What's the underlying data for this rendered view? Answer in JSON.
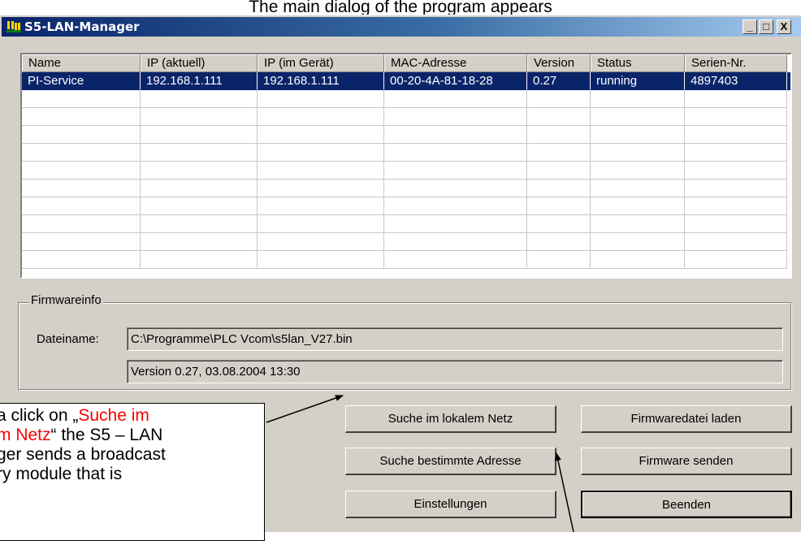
{
  "caption": "The main dialog of the program appears",
  "window": {
    "title": "S5-LAN-Manager",
    "controls": {
      "minimize": "_",
      "maximize": "□",
      "close": "X"
    }
  },
  "table": {
    "columns": [
      "Name",
      "IP (aktuell)",
      "IP (im Gerät)",
      "MAC-Adresse",
      "Version",
      "Status",
      "Serien-Nr."
    ],
    "rows": [
      [
        "PI-Service",
        "192.168.1.111",
        "192.168.1.111",
        "00-20-4A-81-18-28",
        "0.27",
        "running",
        "4897403"
      ]
    ],
    "selected_row": 0
  },
  "firmwareinfo": {
    "legend": "Firmwareinfo",
    "filename_label": "Dateiname:",
    "filename_value": "C:\\Programme\\PLC Vcom\\s5lan_V27.bin",
    "version_value": "Version 0.27, 03.08.2004 13:30"
  },
  "buttons": {
    "search_local": "Suche im lokalem Netz",
    "load_firmware_file": "Firmwaredatei laden",
    "search_address": "Suche bestimmte Adresse",
    "send_firmware": "Firmware senden",
    "settings": "Einstellungen",
    "exit": "Beenden"
  },
  "annotation": {
    "line1_prefix": "a click on „",
    "line1_red": "Suche im",
    "line2_red": "m Netz",
    "line2_suffix": "“ the S5 – LAN",
    "line3": "ger sends a broadcast",
    "line4": "ry module that is"
  }
}
